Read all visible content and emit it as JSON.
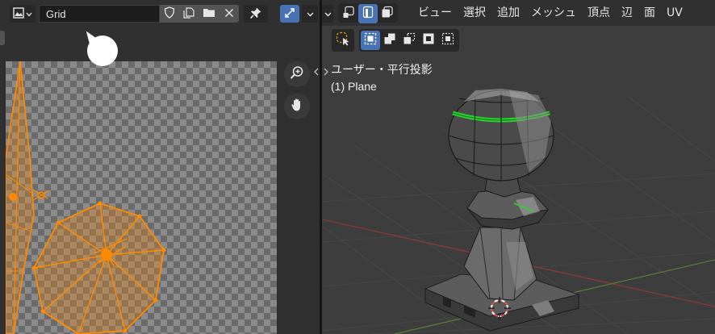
{
  "uv_editor": {
    "image_name": "Grid",
    "header_icons": [
      "image-type-icon",
      "chevron-down-icon",
      "fake-user-shield-icon",
      "duplicate-image-icon",
      "open-folder-icon",
      "unlink-close-icon",
      "pin-icon",
      "uv-sync-selection-icon",
      "chevron-down-icon"
    ],
    "nav_icons": [
      "zoom-icon",
      "pan-hand-icon"
    ]
  },
  "viewport": {
    "menu": [
      "ビュー",
      "選択",
      "追加",
      "メッシュ",
      "頂点",
      "辺",
      "面",
      "UV"
    ],
    "view_label": "ユーザー・平行投影",
    "object_label": "(1) Plane",
    "select_mode_icons": [
      "vertex-select-icon",
      "edge-select-icon",
      "face-select-icon"
    ],
    "active_select_mode": "edge-select-icon",
    "tool_icons": [
      "tweak-select-icon",
      "select-new-icon",
      "select-extend-icon",
      "select-subtract-icon",
      "select-invert-icon",
      "select-intersect-icon"
    ]
  },
  "colors": {
    "accent_blue": "#4772b3",
    "uv_selection": "#ff8a00",
    "seam_green": "#2bd42b",
    "grid_axis_red": "#8c3a3a",
    "grid_axis_green": "#5c7a3a"
  }
}
